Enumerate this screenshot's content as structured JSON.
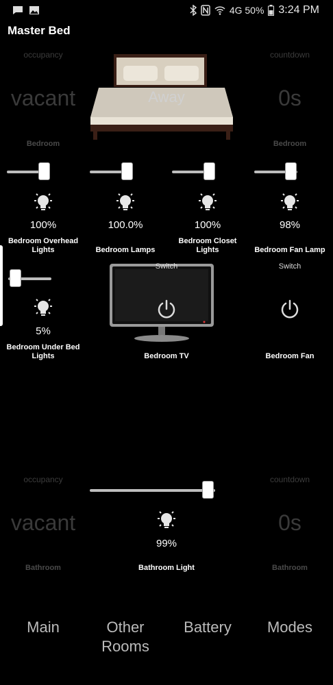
{
  "status_bar": {
    "right_text": "4G  50%",
    "time": "3:24 PM"
  },
  "title": "Master Bed",
  "top_row": {
    "occupancy_label": "occupancy",
    "occupancy_value": "vacant",
    "occupancy_room": "Bedroom",
    "mode_value": "Away",
    "countdown_label": "countdown",
    "countdown_value": "0s",
    "countdown_room": "Bedroom"
  },
  "dimmers": [
    {
      "label_line1": "Bedroom Overhead",
      "label_line2": "Lights",
      "value": "100%",
      "level": 100
    },
    {
      "label_line1": "Bedroom Lamps",
      "label_line2": "",
      "value": "100.0%",
      "level": 100
    },
    {
      "label_line1": "Bedroom Closet",
      "label_line2": "Lights",
      "value": "100%",
      "level": 100
    },
    {
      "label_line1": "Bedroom Fan Lamp",
      "label_line2": "",
      "value": "98%",
      "level": 98
    },
    {
      "label_line1": "Bedroom Under Bed",
      "label_line2": "Lights",
      "value": "5%",
      "level": 5
    }
  ],
  "tv": {
    "top_label": "Switch",
    "label": "Bedroom TV"
  },
  "fan": {
    "top_label": "Switch",
    "label": "Bedroom Fan"
  },
  "bottom_row": {
    "occupancy_label": "occupancy",
    "occupancy_value": "vacant",
    "occupancy_room": "Bathroom",
    "light_value": "99%",
    "light_level": 99,
    "light_label": "Bathroom Light",
    "countdown_label": "countdown",
    "countdown_value": "0s",
    "countdown_room": "Bathroom"
  },
  "nav": {
    "main": "Main",
    "other_line1": "Other",
    "other_line2": "Rooms",
    "battery": "Battery",
    "modes": "Modes"
  },
  "icons": {
    "bulb": "lightbulb-icon",
    "power": "power-icon",
    "bed": "bed-image",
    "tv": "tv-image"
  }
}
